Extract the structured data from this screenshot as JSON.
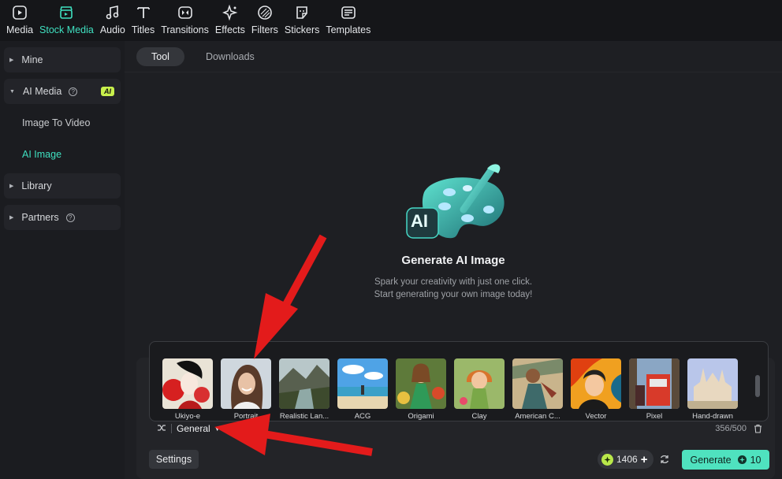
{
  "toolbar": {
    "items": [
      {
        "label": "Media",
        "icon": "media-icon"
      },
      {
        "label": "Stock Media",
        "icon": "stock-media-icon",
        "active": true
      },
      {
        "label": "Audio",
        "icon": "music-note-icon"
      },
      {
        "label": "Titles",
        "icon": "text-t-icon"
      },
      {
        "label": "Transitions",
        "icon": "transitions-icon"
      },
      {
        "label": "Effects",
        "icon": "sparkle-icon"
      },
      {
        "label": "Filters",
        "icon": "filters-icon"
      },
      {
        "label": "Stickers",
        "icon": "sticker-icon"
      },
      {
        "label": "Templates",
        "icon": "templates-icon"
      }
    ]
  },
  "sidebar": {
    "mine": "Mine",
    "ai_media": "AI Media",
    "ai_badge": "AI",
    "image_to_video": "Image To Video",
    "ai_image": "AI Image",
    "library": "Library",
    "partners": "Partners"
  },
  "tabs": {
    "tool": "Tool",
    "downloads": "Downloads"
  },
  "hero": {
    "icon_label": "AI",
    "title": "Generate AI Image",
    "subtitle_line1": "Spark your creativity with just one click.",
    "subtitle_line2": "Start generating your own image today!"
  },
  "styles": [
    {
      "label": "Ukiyo-e"
    },
    {
      "label": "Portrait"
    },
    {
      "label": "Realistic Lan..."
    },
    {
      "label": "ACG"
    },
    {
      "label": "Origami"
    },
    {
      "label": "Clay"
    },
    {
      "label": "American C..."
    },
    {
      "label": "Vector"
    },
    {
      "label": "Pixel"
    },
    {
      "label": "Hand-drawn"
    }
  ],
  "prompt": {
    "style_value": "General",
    "count": "356/500"
  },
  "footer": {
    "settings": "Settings",
    "credits": "1406",
    "generate": "Generate",
    "generate_cost": "10"
  },
  "colors": {
    "accent": "#3fe0c0",
    "generate_bg": "#4fe2bf",
    "ai_badge": "#c8f04c",
    "arrow": "#e31b1b"
  }
}
